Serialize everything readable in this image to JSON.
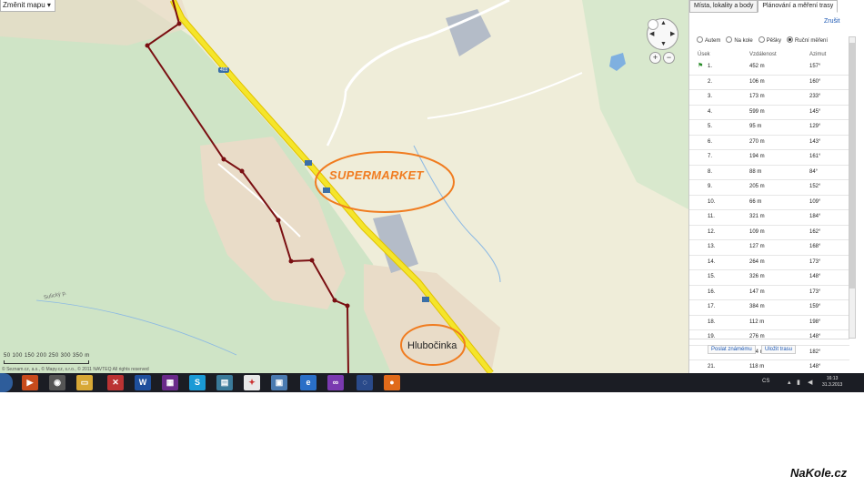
{
  "map": {
    "change_map_label": "Změnit mapu",
    "scale_labels": "50 100 150 200 250 300 350 m",
    "copyright": "© Seznam.cz, a.s., © Mapy.cz, s.r.o., © 2011 NAVTEQ All rights reserved",
    "road_number": "403",
    "stream_label": "Sulický p.",
    "annotation_supermarket": "SUPERMARKET",
    "annotation_town": "Hlubočinka",
    "annotation_color": "#f07c20",
    "route_color": "#7a0f12",
    "road_color": "#f5e52a"
  },
  "panel": {
    "tabs": [
      {
        "label": "Místa, lokality a body"
      },
      {
        "label": "Plánování a měření trasy"
      }
    ],
    "cancel_label": "Zrušit",
    "modes": [
      {
        "label": "Autem",
        "selected": false
      },
      {
        "label": "Na kole",
        "selected": false
      },
      {
        "label": "Pěšky",
        "selected": false
      },
      {
        "label": "Ruční měření",
        "selected": true
      }
    ],
    "columns": {
      "segment": "Úsek",
      "distance": "Vzdálenost",
      "azimuth": "Azimut"
    },
    "segments": [
      {
        "n": "1.",
        "d": "452 m",
        "a": "157°"
      },
      {
        "n": "2.",
        "d": "106 m",
        "a": "160°"
      },
      {
        "n": "3.",
        "d": "173 m",
        "a": "233°"
      },
      {
        "n": "4.",
        "d": "599 m",
        "a": "145°"
      },
      {
        "n": "5.",
        "d": "95 m",
        "a": "129°"
      },
      {
        "n": "6.",
        "d": "270 m",
        "a": "143°"
      },
      {
        "n": "7.",
        "d": "194 m",
        "a": "161°"
      },
      {
        "n": "8.",
        "d": "88 m",
        "a": "84°"
      },
      {
        "n": "9.",
        "d": "205 m",
        "a": "152°"
      },
      {
        "n": "10.",
        "d": "66 m",
        "a": "109°"
      },
      {
        "n": "11.",
        "d": "321 m",
        "a": "184°"
      },
      {
        "n": "12.",
        "d": "109 m",
        "a": "162°"
      },
      {
        "n": "13.",
        "d": "127 m",
        "a": "168°"
      },
      {
        "n": "14.",
        "d": "264 m",
        "a": "173°"
      },
      {
        "n": "15.",
        "d": "326 m",
        "a": "148°"
      },
      {
        "n": "16.",
        "d": "147 m",
        "a": "173°"
      },
      {
        "n": "17.",
        "d": "384 m",
        "a": "159°"
      },
      {
        "n": "18.",
        "d": "112 m",
        "a": "198°"
      },
      {
        "n": "19.",
        "d": "276 m",
        "a": "148°"
      },
      {
        "n": "20.",
        "d": "214 m",
        "a": "182°"
      },
      {
        "n": "21.",
        "d": "118 m",
        "a": "148°"
      }
    ],
    "send_label": "Poslat známému",
    "save_label": "Uložit trasu"
  },
  "taskbar": {
    "lang": "CS",
    "time": "16:13",
    "date": "31.3.2013"
  },
  "watermark": "NaKole.cz"
}
